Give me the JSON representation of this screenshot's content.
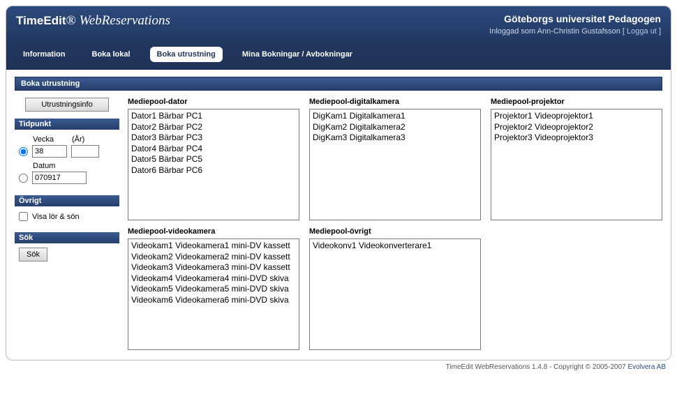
{
  "brand": {
    "name1": "TimeEdit",
    "name2": "WebReservations"
  },
  "org": {
    "title": "Göteborgs universitet Pedagogen",
    "logged_prefix": "Inloggad som ",
    "user": "Ann-Christin Gustafsson",
    "logout_label": "Logga ut"
  },
  "nav": {
    "items": [
      {
        "id": "information",
        "label": "Information"
      },
      {
        "id": "boka-lokal",
        "label": "Boka lokal"
      },
      {
        "id": "boka-utrustning",
        "label": "Boka utrustning",
        "active": true
      },
      {
        "id": "mina-bokningar",
        "label": "Mina Bokningar / Avbokningar"
      }
    ]
  },
  "section_title": "Boka utrustning",
  "sidebar": {
    "info_button": "Utrustningsinfo",
    "tidpunkt": {
      "header": "Tidpunkt",
      "vecka_label": "Vecka",
      "ar_label": "(År)",
      "vecka_value": "38",
      "ar_value": "",
      "datum_label": "Datum",
      "datum_value": "070917"
    },
    "ovrigt": {
      "header": "Övrigt",
      "checkbox_label": "Visa lör & sön"
    },
    "sok": {
      "header": "Sök",
      "button": "Sök"
    }
  },
  "pools": [
    {
      "id": "dator",
      "title": "Mediepool-dator",
      "items": [
        "Dator1 Bärbar PC1",
        "Dator2 Bärbar PC2",
        "Dator3 Bärbar PC3",
        "Dator4 Bärbar PC4",
        "Dator5 Bärbar PC5",
        "Dator6 Bärbar PC6"
      ]
    },
    {
      "id": "digitalkamera",
      "title": "Mediepool-digitalkamera",
      "items": [
        "DigKam1 Digitalkamera1",
        "DigKam2 Digitalkamera2",
        "DigKam3 Digitalkamera3"
      ]
    },
    {
      "id": "projektor",
      "title": "Mediepool-projektor",
      "items": [
        "Projektor1 Videoprojektor1",
        "Projektor2 Videoprojektor2",
        "Projektor3 Videoprojektor3"
      ]
    },
    {
      "id": "videokamera",
      "title": "Mediepool-videokamera",
      "items": [
        "Videokam1 Videokamera1 mini-DV kassett",
        "Videokam2 Videokamera2 mini-DV kassett",
        "Videokam3 Videokamera3 mini-DV kassett",
        "Videokam4 Videokamera4 mini-DVD skiva",
        "Videokam5 Videokamera5 mini-DVD skiva",
        "Videokam6 Videokamera6 mini-DVD skiva"
      ]
    },
    {
      "id": "ovrigt",
      "title": "Mediepool-övrigt",
      "items": [
        "Videokonv1 Videokonverterare1"
      ]
    }
  ],
  "footer": {
    "text": "TimeEdit WebReservations 1.4.8 - Copyright © 2005-2007 ",
    "link": "Evolvera AB"
  }
}
